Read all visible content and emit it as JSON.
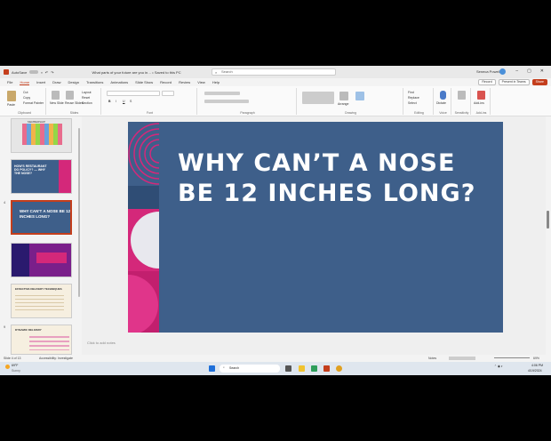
{
  "titlebar": {
    "app_label": "AutoSave",
    "toggle_state": "Off",
    "doc_title": "What parts of your future are you in… • Saved to this PC",
    "search_placeholder": "Search",
    "user_name": "Seneca Powell",
    "minimize": "–",
    "restore": "▢",
    "close": "✕"
  },
  "menu": {
    "items": [
      "File",
      "Home",
      "Insert",
      "Draw",
      "Design",
      "Transitions",
      "Animations",
      "Slide Show",
      "Record",
      "Review",
      "View",
      "Help"
    ],
    "active_index": 1,
    "record": "Record",
    "present": "Present in Teams",
    "share": "Share"
  },
  "ribbon": {
    "groups": [
      "Clipboard",
      "Slides",
      "Font",
      "Paragraph",
      "Drawing",
      "Editing",
      "Voice",
      "Sensitivity",
      "Add-ins"
    ],
    "clipboard": {
      "paste": "Paste",
      "cut": "Cut",
      "copy": "Copy",
      "format_painter": "Format Painter"
    },
    "slides": {
      "new_slide": "New Slide",
      "reuse_slides": "Reuse Slides",
      "layout": "Layout",
      "reset": "Reset",
      "section": "Section"
    },
    "editing": {
      "find": "Find",
      "replace": "Replace",
      "select": "Select"
    },
    "voice": {
      "dictate": "Dictate"
    },
    "sensitivity": {
      "label": "Sensitivity"
    },
    "addins": {
      "label": "Add-ins"
    },
    "drawing": {
      "arrange": "Arrange"
    }
  },
  "slides_panel": {
    "thumbs": [
      {
        "num": "",
        "title": "MEMBERSHIP",
        "bg": "#e6e6e6"
      },
      {
        "num": "",
        "title": "HOW'S RESTAURANT DO POLICY? — WHY THE NOSE?",
        "bg": "#3e5f8a"
      },
      {
        "num": "4",
        "title": "WHY CAN'T A NOSE BE 12 INCHES LONG?",
        "bg": "#3e5f8a"
      },
      {
        "num": "",
        "title": "",
        "bg": "#7a1f8a"
      },
      {
        "num": "",
        "title": "EFFECTIVE DELIVERY TECHNIQUES",
        "bg": "#f6efe0"
      },
      {
        "num": "9",
        "title": "DYNAMIC DELIVERY",
        "bg": "#f6efe0"
      }
    ],
    "selected_index": 2
  },
  "slide": {
    "title_line1": "WHY CAN’T A NOSE",
    "title_line2": "BE 12 INCHES LONG?",
    "bg_color": "#3e5f8a",
    "accent_color": "#d4287a"
  },
  "notes_placeholder": "Click to add notes",
  "statusbar": {
    "slide_info": "Slide 4 of 13",
    "accessibility": "Accessibility: Investigate",
    "notes": "Notes",
    "zoom": "69%"
  },
  "taskbar": {
    "weather_temp": "69°F",
    "weather_desc": "Sunny",
    "search": "Search",
    "time": "4:06 PM",
    "date": "4/19/2024"
  }
}
